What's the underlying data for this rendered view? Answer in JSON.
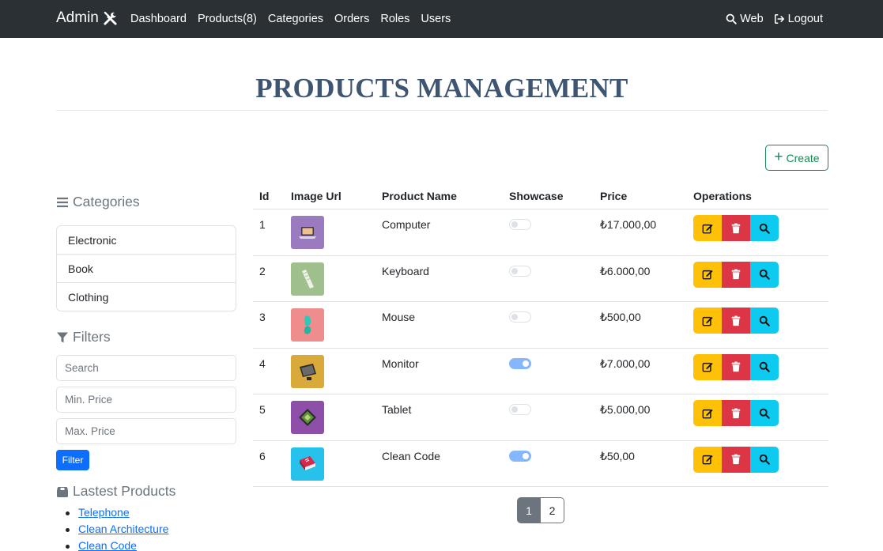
{
  "nav": {
    "brand": "Admin",
    "links": [
      "Dashboard",
      "Products(8)",
      "Categories",
      "Orders",
      "Roles",
      "Users"
    ],
    "web": "Web",
    "logout": "Logout"
  },
  "page": {
    "title": "PRODUCTS MANAGEMENT",
    "create_label": "Create"
  },
  "sidebar": {
    "categories_heading": "Categories",
    "categories": [
      "Electronic",
      "Book",
      "Clothing"
    ],
    "filters_heading": "Filters",
    "search_placeholder": "Search",
    "min_price_placeholder": "Min. Price",
    "max_price_placeholder": "Max. Price",
    "filter_label": "Filter",
    "latest_heading": "Lastest Products",
    "latest": [
      "Telephone",
      "Clean Architecture",
      "Clean Code"
    ]
  },
  "table": {
    "headers": [
      "Id",
      "Image Url",
      "Product Name",
      "Showcase",
      "Price",
      "Operations"
    ],
    "rows": [
      {
        "id": "1",
        "name": "Computer",
        "showcase": false,
        "price": "₺17.000,00",
        "thumb_color": "#9b7bbf",
        "icon": "laptop-icon"
      },
      {
        "id": "2",
        "name": "Keyboard",
        "showcase": false,
        "price": "₺6.000,00",
        "thumb_color": "#9fbf8c",
        "icon": "keyboard-icon"
      },
      {
        "id": "3",
        "name": "Mouse",
        "showcase": false,
        "price": "₺500,00",
        "thumb_color": "#ef8c8c",
        "icon": "mouse-icon"
      },
      {
        "id": "4",
        "name": "Monitor",
        "showcase": true,
        "price": "₺7.000,00",
        "thumb_color": "#d9a93a",
        "icon": "monitor-icon"
      },
      {
        "id": "5",
        "name": "Tablet",
        "showcase": false,
        "price": "₺5.000,00",
        "thumb_color": "#8e4fa8",
        "icon": "tablet-icon"
      },
      {
        "id": "6",
        "name": "Clean Code",
        "showcase": true,
        "price": "₺50,00",
        "thumb_color": "#27c2ec",
        "icon": "book-icon"
      }
    ]
  },
  "pagination": {
    "pages": [
      "1",
      "2"
    ],
    "active": "1"
  },
  "colors": {
    "navbar": "#2b3035",
    "title": "#3f5672",
    "create": "#198754",
    "edit": "#ffc107",
    "delete": "#dc3545",
    "view": "#0dcaf0",
    "filter": "#0d6efd"
  }
}
